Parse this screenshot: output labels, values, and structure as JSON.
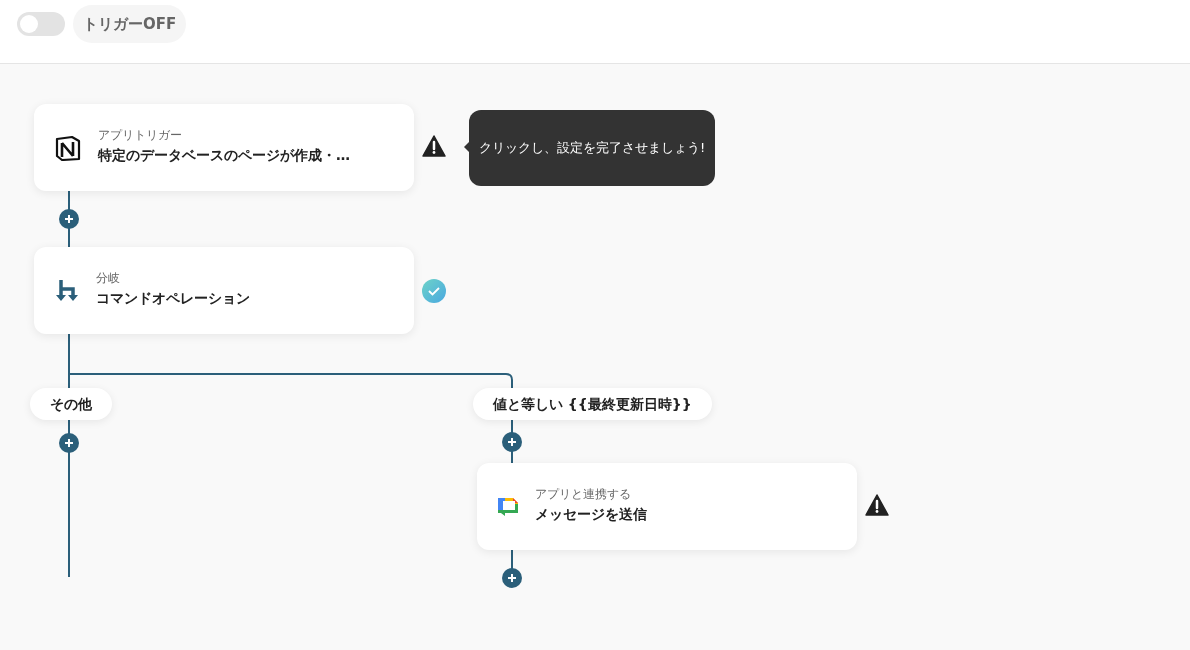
{
  "trigger_toggle": {
    "on": false,
    "label": "トリガーOFF"
  },
  "tooltip": {
    "text": "クリックし、設定を完了させましょう!"
  },
  "nodes": [
    {
      "kind": "app",
      "caption": "アプリトリガー",
      "title": "特定のデータベースのページが作成・…",
      "completed": false
    },
    {
      "kind": "branch",
      "caption": "分岐",
      "title": "コマンドオペレーション",
      "completed": true
    },
    {
      "kind": "chat",
      "caption": "アプリと連携する",
      "title": "メッセージを送信",
      "completed": false
    }
  ],
  "branches": [
    {
      "label": "その他"
    },
    {
      "label": "値と等しい {{最終更新日時}}"
    }
  ]
}
